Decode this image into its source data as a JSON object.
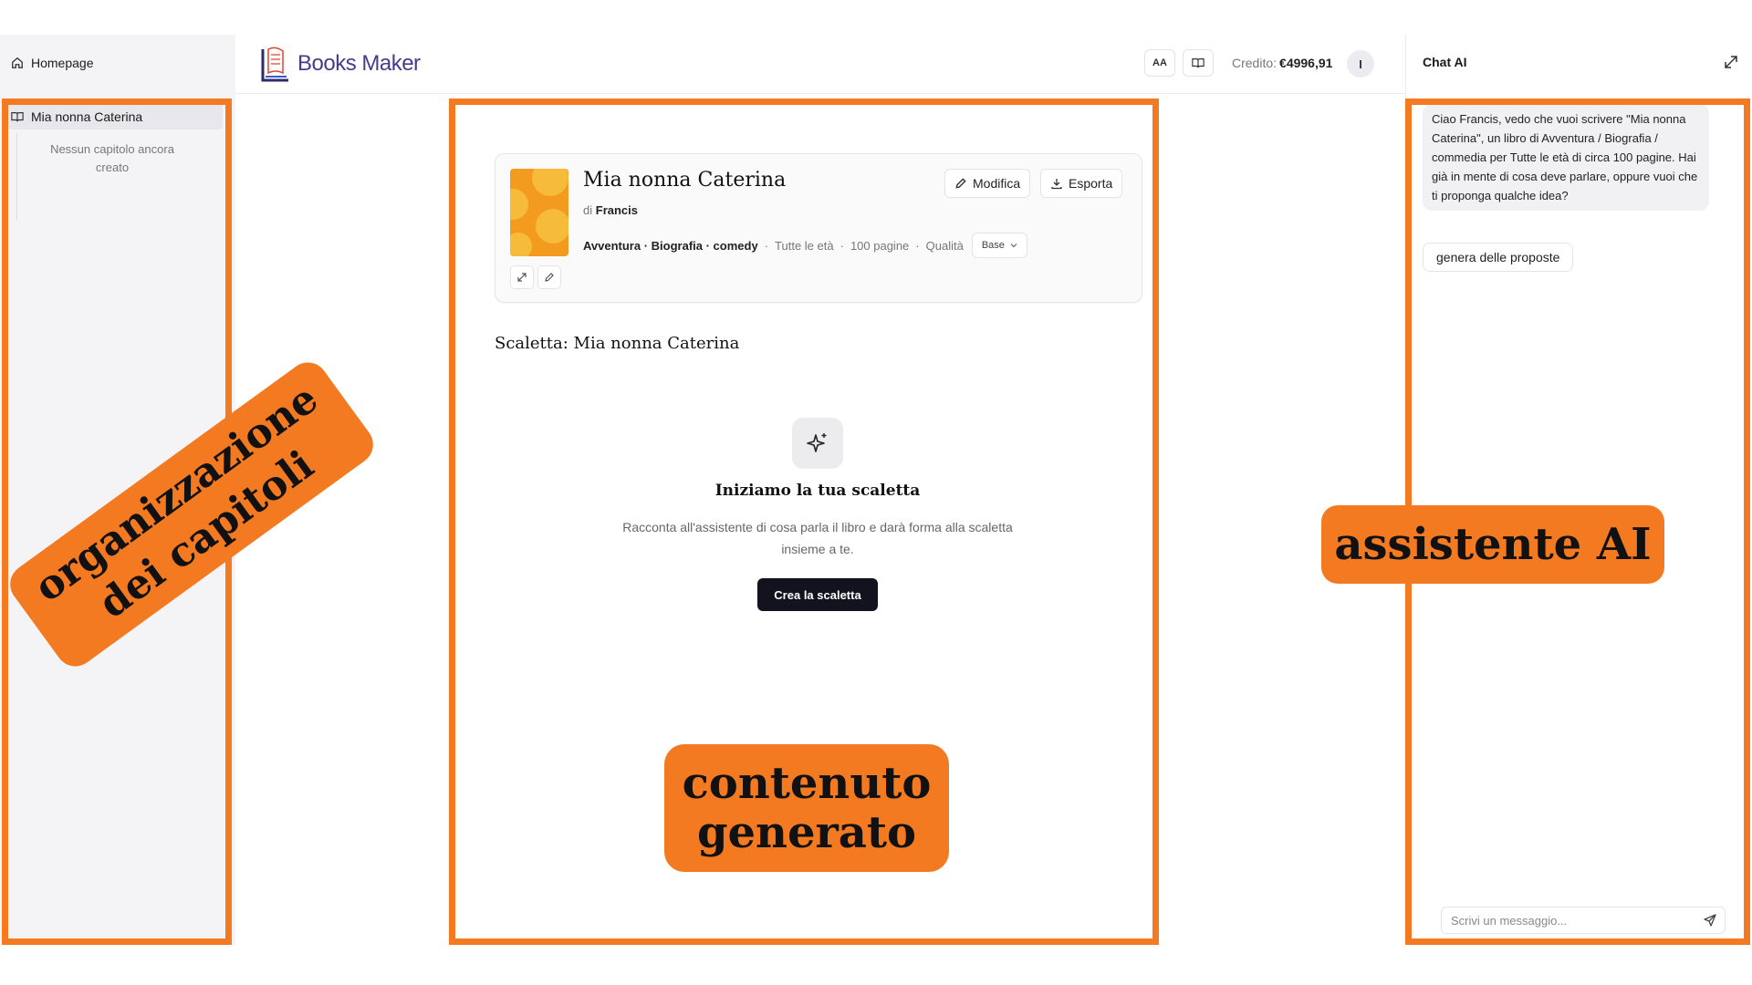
{
  "sidebar": {
    "home_label": "Homepage",
    "book_label": "Mia nonna Caterina",
    "empty_text": "Nessun capitolo ancora creato"
  },
  "header": {
    "logo_text": "Books Maker",
    "font_button": "AA",
    "credit_label": "Credito:",
    "credit_value": "€4996,91",
    "avatar_initial": "I"
  },
  "book": {
    "title": "Mia nonna Caterina",
    "author_prefix": "di",
    "author": "Francis",
    "genres": "Avventura · Biografia · comedy",
    "age": "Tutte le età",
    "pages": "100 pagine",
    "quality_label": "Qualità",
    "quality_value": "Base",
    "edit_label": "Modifica",
    "export_label": "Esporta"
  },
  "outline": {
    "title": "Scaletta: Mia nonna Caterina",
    "empty_title": "Iniziamo la tua scaletta",
    "empty_desc": "Racconta all'assistente di cosa parla il libro e darà forma alla scaletta insieme a te.",
    "cta_label": "Crea la scaletta"
  },
  "chat": {
    "title": "Chat AI",
    "message": "Ciao Francis, vedo che vuoi scrivere \"Mia nonna Caterina\", un libro di Avventura / Biografia / commedia per Tutte le età di circa 100 pagine. Hai già in mente di cosa deve parlare, oppure vuoi che ti proponga qualche idea?",
    "suggestion": "genera delle proposte",
    "input_placeholder": "Scrivi un messaggio..."
  },
  "annotations": {
    "left_label_line1": "organizzazione",
    "left_label_line2": "dei capitoli",
    "center_label_line1": "contenuto",
    "center_label_line2": "generato",
    "right_label": "assistente AI"
  },
  "colors": {
    "annotation_orange": "#f47a22",
    "brand_purple": "#4b3a8c",
    "primary_dark": "#13131f"
  }
}
